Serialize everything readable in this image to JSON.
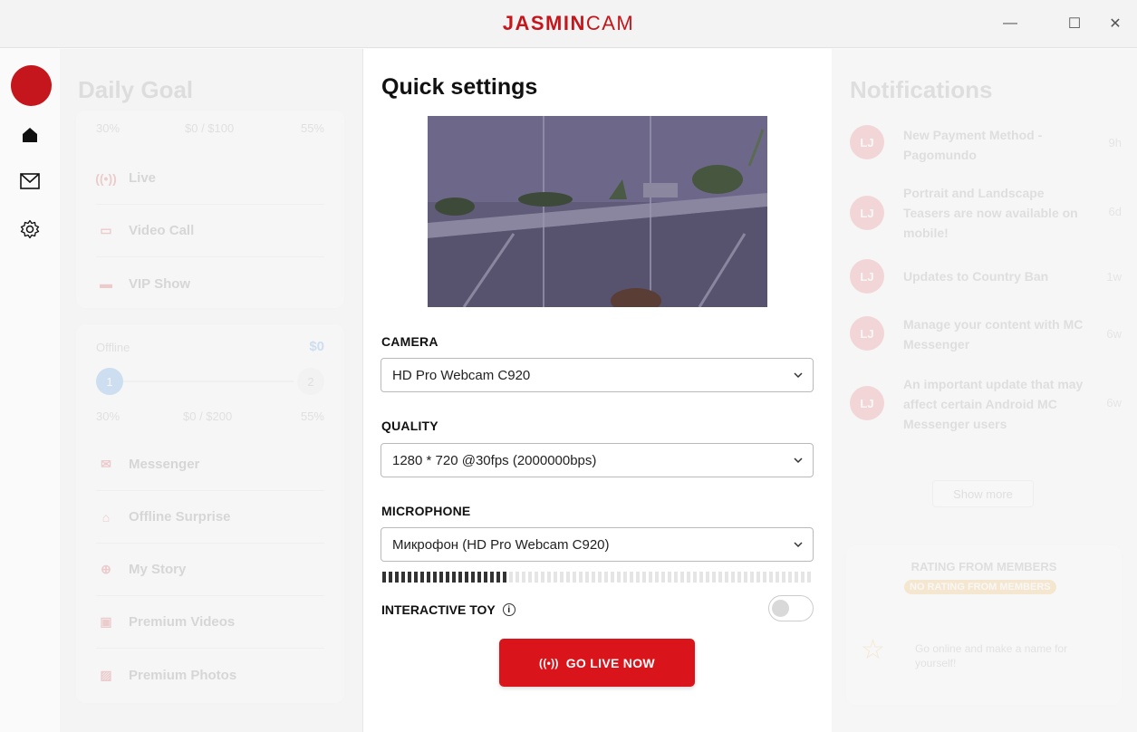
{
  "window": {
    "logo_bold": "JASMIN",
    "logo_light": "CAM",
    "minimize_label": "—",
    "maximize_label": "☐",
    "close_label": "✕"
  },
  "colors": {
    "brand": "#c4161c",
    "button": "#d9151b"
  },
  "rail": {
    "icons": [
      "home-icon",
      "mail-icon",
      "gear-icon"
    ]
  },
  "left_panel": {
    "title": "Daily Goal",
    "top_row": {
      "left": "30%",
      "middle": "$0 / $100",
      "right": "55%"
    },
    "menu1": [
      {
        "label": "Live",
        "icon": "live-icon"
      },
      {
        "label": "Video Call",
        "icon": "video-icon"
      },
      {
        "label": "VIP Show",
        "icon": "vip-icon"
      }
    ],
    "offline_label": "Offline",
    "offline_amount": "$0",
    "step1": "1",
    "step2": "2",
    "progress_left": "30%",
    "progress_mid": "$0 / $200",
    "progress_right": "55%",
    "menu2": [
      {
        "label": "Messenger",
        "icon": "mail-icon"
      },
      {
        "label": "Offline Surprise",
        "icon": "gift-icon"
      },
      {
        "label": "My Story",
        "icon": "story-icon"
      },
      {
        "label": "Premium Videos",
        "icon": "video-icon"
      },
      {
        "label": "Premium Photos",
        "icon": "photo-icon"
      }
    ]
  },
  "quick_settings": {
    "title": "Quick settings",
    "camera_label": "CAMERA",
    "camera_value": "HD Pro Webcam C920",
    "quality_label": "QUALITY",
    "quality_value": "1280 * 720 @30fps (2000000bps)",
    "microphone_label": "MICROPHONE",
    "microphone_value": "Микрофон (HD Pro Webcam C920)",
    "mic_level": 0.3,
    "toy_label": "INTERACTIVE TOY",
    "toy_enabled": false,
    "go_live_label": "GO LIVE NOW",
    "live_glyph": "((•))"
  },
  "notifications": {
    "title": "Notifications",
    "items": [
      {
        "initials": "LJ",
        "text": "New Payment Method - Pagomundo",
        "time": "9h"
      },
      {
        "initials": "LJ",
        "text": "Portrait and Landscape Teasers are now available on mobile!",
        "time": "6d"
      },
      {
        "initials": "LJ",
        "text": "Updates to Country Ban",
        "time": "1w"
      },
      {
        "initials": "LJ",
        "text": "Manage your content with MC Messenger",
        "time": "6w"
      },
      {
        "initials": "LJ",
        "text": "An important update that may affect certain Android MC Messenger users",
        "time": "6w"
      }
    ],
    "show_more": "Show more",
    "rating_title": "RATING FROM MEMBERS",
    "rating_badge": "NO RATING FROM MEMBERS",
    "rating_text": "Go online and make a name for yourself!"
  }
}
